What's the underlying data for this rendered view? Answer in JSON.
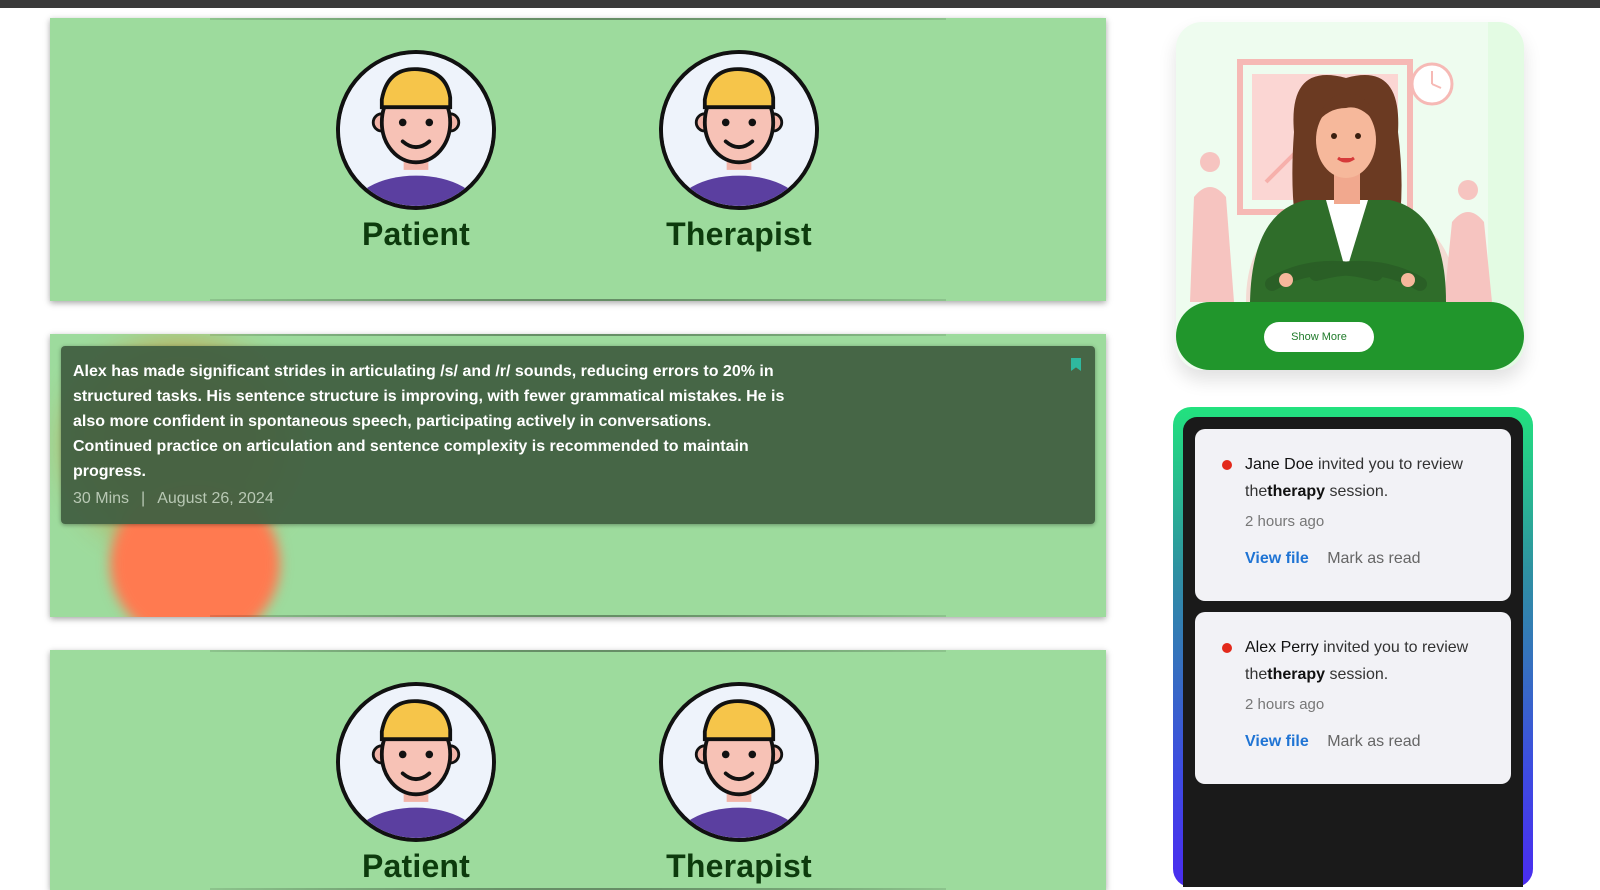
{
  "session_cards": [
    {
      "roles": [
        "Patient",
        "Therapist"
      ]
    },
    {
      "summary": "Alex has made significant strides in articulating /s/ and /r/ sounds, reducing errors to 20% in structured tasks. His sentence structure is improving, with fewer grammatical mistakes. He is also more confident in spontaneous speech, participating actively in conversations. Continued practice on articulation and sentence complexity is recommended to maintain progress.",
      "duration": "30 Mins",
      "separator": "|",
      "date": "August 26, 2024"
    },
    {
      "roles": [
        "Patient",
        "Therapist"
      ]
    }
  ],
  "promo": {
    "button_label": "Show More"
  },
  "notifications": [
    {
      "sender": "Jane Doe",
      "message_pre": "invited you to review the",
      "message_bold": "therapy",
      "message_post": "session.",
      "time": "2 hours ago",
      "view_label": "View file",
      "mark_label": "Mark as read"
    },
    {
      "sender": "Alex Perry",
      "message_pre": "invited you to review the",
      "message_bold": "therapy",
      "message_post": "session.",
      "time": "2 hours ago",
      "view_label": "View file",
      "mark_label": "Mark as read"
    }
  ],
  "colors": {
    "card_bg": "#9ddb9d",
    "note_bg": "#436143",
    "promo_green": "#21962c",
    "link_blue": "#1f74d4",
    "unread_dot": "#e3291b"
  }
}
